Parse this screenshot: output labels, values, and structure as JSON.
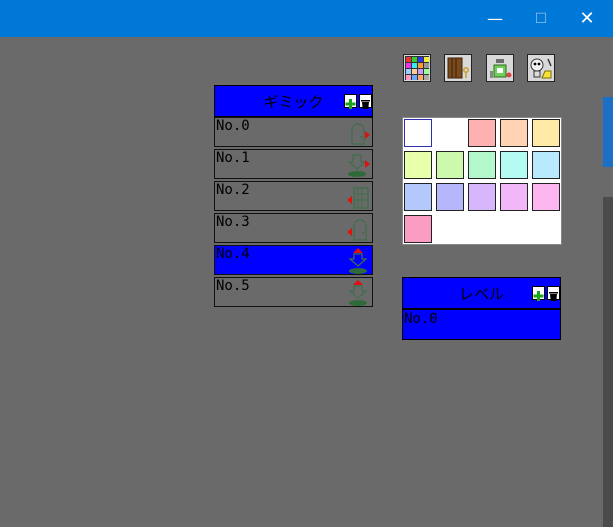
{
  "window": {
    "minimize_glyph": "—",
    "maximize_glyph": "☐",
    "close_glyph": "✕"
  },
  "toolbar": {
    "tools": [
      {
        "name": "tile-palette-icon"
      },
      {
        "name": "door-key-icon"
      },
      {
        "name": "potion-bottle-icon"
      },
      {
        "name": "skull-scroll-icon"
      }
    ]
  },
  "gimmick": {
    "title": "ギミック",
    "items": [
      {
        "label": "No.0",
        "icon": "door-arrow-right-icon"
      },
      {
        "label": "No.1",
        "icon": "down-arrow-warp-icon"
      },
      {
        "label": "No.2",
        "icon": "grid-arrow-left-icon"
      },
      {
        "label": "No.3",
        "icon": "door-arrow-left-icon"
      },
      {
        "label": "No.4",
        "icon": "up-down-arrow-warp-icon",
        "selected": true
      },
      {
        "label": "No.5",
        "icon": "up-down-arrow-warp-icon"
      }
    ]
  },
  "palette": {
    "colors": [
      "#ffffff",
      "#ffffff",
      "#ffb1b1",
      "#ffd3b4",
      "#ffeaa8",
      "#e8ffac",
      "#cdf9ad",
      "#b5f7cd",
      "#b6fbf3",
      "#b9e9fd",
      "#b3c9fb",
      "#b6b6fb",
      "#d6b7fb",
      "#f2b7f7",
      "#fdb7f0",
      "#fb9dc2"
    ]
  },
  "level": {
    "title": "レベル",
    "items": [
      {
        "label": "No.0",
        "selected": true
      }
    ]
  }
}
